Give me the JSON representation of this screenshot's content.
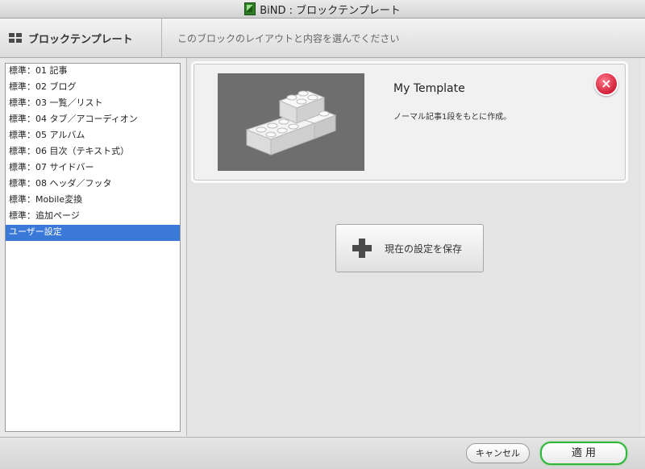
{
  "window": {
    "title": "BiND : ブロックテンプレート"
  },
  "header": {
    "title": "ブロックテンプレート",
    "description": "このブロックのレイアウトと内容を選んでください"
  },
  "template_list": {
    "items": [
      "標準：01 記事",
      "標準：02 ブログ",
      "標準：03 一覧／リスト",
      "標準：04 タブ／アコーディオン",
      "標準：05 アルバム",
      "標準：06 目次（テキスト式）",
      "標準：07 サイドバー",
      "標準：08 ヘッダ／フッタ",
      "標準：Mobile変換",
      "標準：追加ページ",
      "ユーザー設定"
    ],
    "selected_index": 10
  },
  "template_card": {
    "name": "My Template",
    "description": "ノーマル記事1段をもとに作成。",
    "delete_icon": "close-icon"
  },
  "save_button": {
    "label": "現在の設定を保存",
    "icon": "plus-icon"
  },
  "footer": {
    "cancel_label": "キャンセル",
    "apply_label": "適 用"
  },
  "colors": {
    "selection": "#3b79d9",
    "delete": "#d21f3a",
    "apply_border": "#2fb53a"
  }
}
